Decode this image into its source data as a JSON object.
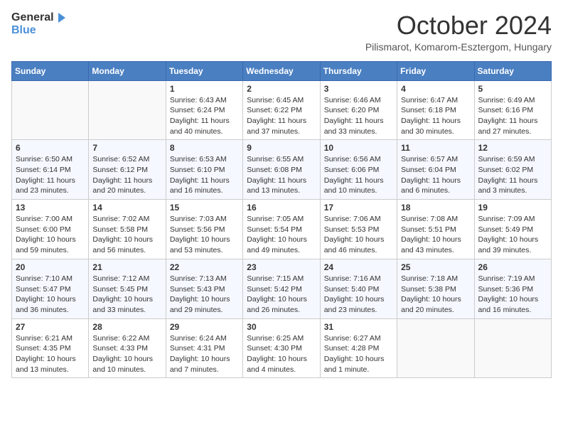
{
  "header": {
    "logo_text_general": "General",
    "logo_text_blue": "Blue",
    "month": "October 2024",
    "location": "Pilismarot, Komarom-Esztergom, Hungary"
  },
  "days_of_week": [
    "Sunday",
    "Monday",
    "Tuesday",
    "Wednesday",
    "Thursday",
    "Friday",
    "Saturday"
  ],
  "weeks": [
    [
      {
        "day": "",
        "info": ""
      },
      {
        "day": "",
        "info": ""
      },
      {
        "day": "1",
        "info": "Sunrise: 6:43 AM\nSunset: 6:24 PM\nDaylight: 11 hours and 40 minutes."
      },
      {
        "day": "2",
        "info": "Sunrise: 6:45 AM\nSunset: 6:22 PM\nDaylight: 11 hours and 37 minutes."
      },
      {
        "day": "3",
        "info": "Sunrise: 6:46 AM\nSunset: 6:20 PM\nDaylight: 11 hours and 33 minutes."
      },
      {
        "day": "4",
        "info": "Sunrise: 6:47 AM\nSunset: 6:18 PM\nDaylight: 11 hours and 30 minutes."
      },
      {
        "day": "5",
        "info": "Sunrise: 6:49 AM\nSunset: 6:16 PM\nDaylight: 11 hours and 27 minutes."
      }
    ],
    [
      {
        "day": "6",
        "info": "Sunrise: 6:50 AM\nSunset: 6:14 PM\nDaylight: 11 hours and 23 minutes."
      },
      {
        "day": "7",
        "info": "Sunrise: 6:52 AM\nSunset: 6:12 PM\nDaylight: 11 hours and 20 minutes."
      },
      {
        "day": "8",
        "info": "Sunrise: 6:53 AM\nSunset: 6:10 PM\nDaylight: 11 hours and 16 minutes."
      },
      {
        "day": "9",
        "info": "Sunrise: 6:55 AM\nSunset: 6:08 PM\nDaylight: 11 hours and 13 minutes."
      },
      {
        "day": "10",
        "info": "Sunrise: 6:56 AM\nSunset: 6:06 PM\nDaylight: 11 hours and 10 minutes."
      },
      {
        "day": "11",
        "info": "Sunrise: 6:57 AM\nSunset: 6:04 PM\nDaylight: 11 hours and 6 minutes."
      },
      {
        "day": "12",
        "info": "Sunrise: 6:59 AM\nSunset: 6:02 PM\nDaylight: 11 hours and 3 minutes."
      }
    ],
    [
      {
        "day": "13",
        "info": "Sunrise: 7:00 AM\nSunset: 6:00 PM\nDaylight: 10 hours and 59 minutes."
      },
      {
        "day": "14",
        "info": "Sunrise: 7:02 AM\nSunset: 5:58 PM\nDaylight: 10 hours and 56 minutes."
      },
      {
        "day": "15",
        "info": "Sunrise: 7:03 AM\nSunset: 5:56 PM\nDaylight: 10 hours and 53 minutes."
      },
      {
        "day": "16",
        "info": "Sunrise: 7:05 AM\nSunset: 5:54 PM\nDaylight: 10 hours and 49 minutes."
      },
      {
        "day": "17",
        "info": "Sunrise: 7:06 AM\nSunset: 5:53 PM\nDaylight: 10 hours and 46 minutes."
      },
      {
        "day": "18",
        "info": "Sunrise: 7:08 AM\nSunset: 5:51 PM\nDaylight: 10 hours and 43 minutes."
      },
      {
        "day": "19",
        "info": "Sunrise: 7:09 AM\nSunset: 5:49 PM\nDaylight: 10 hours and 39 minutes."
      }
    ],
    [
      {
        "day": "20",
        "info": "Sunrise: 7:10 AM\nSunset: 5:47 PM\nDaylight: 10 hours and 36 minutes."
      },
      {
        "day": "21",
        "info": "Sunrise: 7:12 AM\nSunset: 5:45 PM\nDaylight: 10 hours and 33 minutes."
      },
      {
        "day": "22",
        "info": "Sunrise: 7:13 AM\nSunset: 5:43 PM\nDaylight: 10 hours and 29 minutes."
      },
      {
        "day": "23",
        "info": "Sunrise: 7:15 AM\nSunset: 5:42 PM\nDaylight: 10 hours and 26 minutes."
      },
      {
        "day": "24",
        "info": "Sunrise: 7:16 AM\nSunset: 5:40 PM\nDaylight: 10 hours and 23 minutes."
      },
      {
        "day": "25",
        "info": "Sunrise: 7:18 AM\nSunset: 5:38 PM\nDaylight: 10 hours and 20 minutes."
      },
      {
        "day": "26",
        "info": "Sunrise: 7:19 AM\nSunset: 5:36 PM\nDaylight: 10 hours and 16 minutes."
      }
    ],
    [
      {
        "day": "27",
        "info": "Sunrise: 6:21 AM\nSunset: 4:35 PM\nDaylight: 10 hours and 13 minutes."
      },
      {
        "day": "28",
        "info": "Sunrise: 6:22 AM\nSunset: 4:33 PM\nDaylight: 10 hours and 10 minutes."
      },
      {
        "day": "29",
        "info": "Sunrise: 6:24 AM\nSunset: 4:31 PM\nDaylight: 10 hours and 7 minutes."
      },
      {
        "day": "30",
        "info": "Sunrise: 6:25 AM\nSunset: 4:30 PM\nDaylight: 10 hours and 4 minutes."
      },
      {
        "day": "31",
        "info": "Sunrise: 6:27 AM\nSunset: 4:28 PM\nDaylight: 10 hours and 1 minute."
      },
      {
        "day": "",
        "info": ""
      },
      {
        "day": "",
        "info": ""
      }
    ]
  ]
}
